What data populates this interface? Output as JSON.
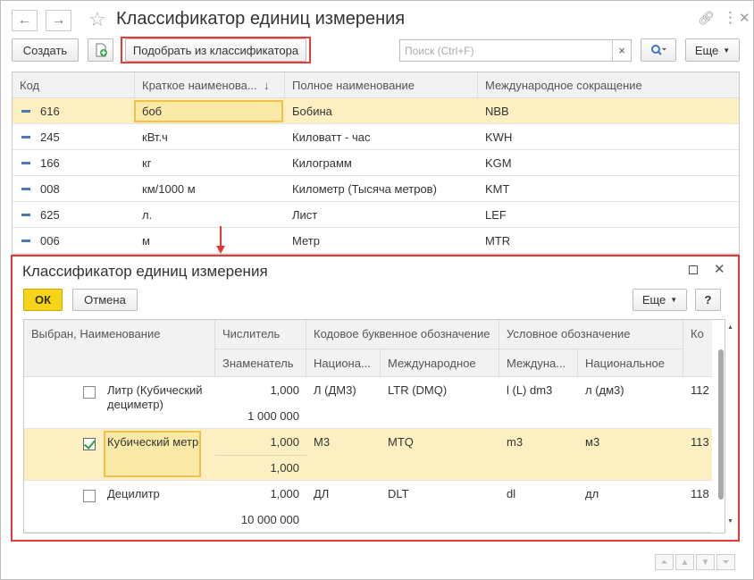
{
  "window": {
    "title": "Классификатор единиц измерения",
    "nav_back": "←",
    "nav_forward": "→"
  },
  "toolbar": {
    "create_label": "Создать",
    "pick_label": "Подобрать из классификатора",
    "search_placeholder": "Поиск (Ctrl+F)",
    "clear_label": "×",
    "more_label": "Еще"
  },
  "main_table": {
    "columns": [
      "Код",
      "Краткое наименова...",
      "Полное наименование",
      "Международное сокращение"
    ],
    "sort_indicator": "↓",
    "rows": [
      {
        "code": "616",
        "short": "боб",
        "full": "Бобина",
        "intl": "NBB"
      },
      {
        "code": "245",
        "short": "кВт.ч",
        "full": "Киловатт - час",
        "intl": "KWH"
      },
      {
        "code": "166",
        "short": "кг",
        "full": "Килограмм",
        "intl": "KGM"
      },
      {
        "code": "008",
        "short": "км/1000 м",
        "full": "Километр (Тысяча метров)",
        "intl": "KMT"
      },
      {
        "code": "625",
        "short": "л.",
        "full": "Лист",
        "intl": "LEF"
      },
      {
        "code": "006",
        "short": "м",
        "full": "Метр",
        "intl": "MTR"
      }
    ]
  },
  "dialog": {
    "title": "Классификатор единиц измерения",
    "ok_label": "ОК",
    "cancel_label": "Отмена",
    "more_label": "Еще",
    "help_label": "?",
    "headers": {
      "name": "Выбран, Наименование",
      "numerator": "Числитель",
      "denominator": "Знаменатель",
      "letter_code": "Кодовое буквенное обозначение",
      "national": "Национа...",
      "international": "Международное",
      "symbol": "Условное обозначение",
      "symbol_intl": "Междуна...",
      "symbol_national": "Национальное",
      "code": "Ко"
    },
    "rows": [
      {
        "checked": false,
        "name": "Литр (Кубический дециметр)",
        "numerator": "1,000",
        "denominator": "1 000 000",
        "national": "Л (ДМ3)",
        "international": "LTR (DMQ)",
        "symbol_intl": "l (L) dm3",
        "symbol_national": "л (дм3)",
        "code": "112"
      },
      {
        "checked": true,
        "name": "Кубический метр",
        "numerator": "1,000",
        "denominator": "1,000",
        "national": "М3",
        "international": "MTQ",
        "symbol_intl": "m3",
        "symbol_national": "м3",
        "code": "113"
      },
      {
        "checked": false,
        "name": "Децилитр",
        "numerator": "1,000",
        "denominator": "10 000 000",
        "national": "ДЛ",
        "international": "DLT",
        "symbol_intl": "dl",
        "symbol_national": "дл",
        "code": "118"
      }
    ]
  },
  "colors": {
    "accent_red": "#e53935",
    "selection": "#fcf0c3",
    "ok_yellow": "#f7d417"
  }
}
